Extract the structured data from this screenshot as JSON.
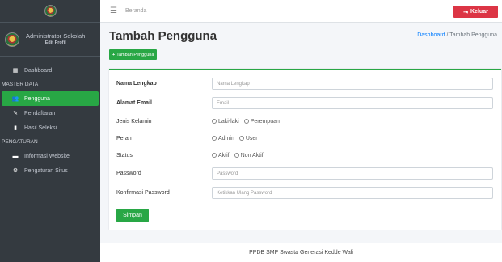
{
  "sidebar": {
    "user_name": "Administrator Sekolah",
    "user_edit": "Edit Profil",
    "items": [
      {
        "label": "Dashboard",
        "icon": "dashboard-icon"
      },
      {
        "header": "MASTER DATA"
      },
      {
        "label": "Pengguna",
        "icon": "users-icon",
        "active": true
      },
      {
        "label": "Pendaftaran",
        "icon": "pencil-icon"
      },
      {
        "label": "Hasil Seleksi",
        "icon": "file-icon"
      },
      {
        "header": "PENGATURAN"
      },
      {
        "label": "Informasi Website",
        "icon": "laptop-icon"
      },
      {
        "label": "Pengaturan Situs",
        "icon": "cogs-icon"
      }
    ],
    "headers": [
      "MASTER DATA",
      "PENGATURAN"
    ]
  },
  "topbar": {
    "home_link": "Beranda",
    "logout_label": "Keluar"
  },
  "content": {
    "title": "Tambah Pengguna",
    "breadcrumb_home": "Dashboard",
    "breadcrumb_sep": "/",
    "breadcrumb_current": "Tambah Pengguna",
    "add_button": "Tambah Pengguna"
  },
  "form": {
    "nama_label": "Nama Lengkap",
    "nama_placeholder": "Nama Lengkap",
    "email_label": "Alamat Email",
    "email_placeholder": "Email",
    "jk_label": "Jenis Kelamin",
    "jk_options": [
      "Laki-laki",
      "Perempuan"
    ],
    "peran_label": "Peran",
    "peran_options": [
      "Admin",
      "User"
    ],
    "status_label": "Status",
    "status_options": [
      "Aktif",
      "Non Aktif"
    ],
    "password_label": "Password",
    "password_placeholder": "Password",
    "konfirmasi_label": "Konfirmasi Password",
    "konfirmasi_placeholder": "Ketikkan Ulang Password",
    "save_label": "Simpan"
  },
  "footer": {
    "text": "PPDB SMP Swasta Generasi Kedde Wali"
  },
  "colors": {
    "accent": "#28a745",
    "danger": "#dc3545",
    "sidebar": "#343a40"
  }
}
